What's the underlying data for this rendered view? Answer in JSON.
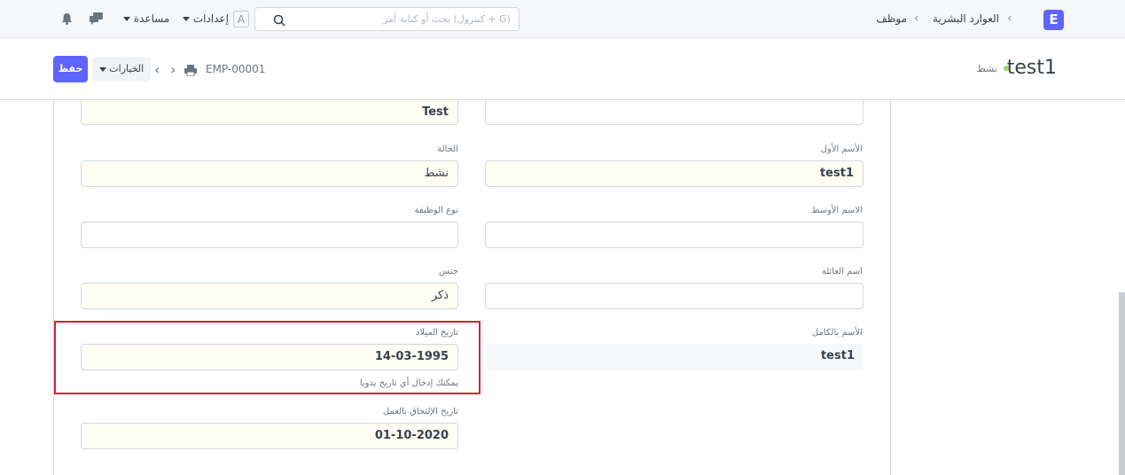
{
  "navbar": {
    "logo_letter": "E",
    "breadcrumbs": [
      "العوارد البشرية",
      "موظف"
    ],
    "search_placeholder": "بحث أو كتابة أمر (كنترول + G)",
    "avatar_letter": "A",
    "settings_label": "إعدادات",
    "help_label": "مساعدة"
  },
  "page_head": {
    "title": "test1",
    "status": "نشط",
    "status_color": "#98d85b",
    "doc_id": "EMP-00001",
    "options_label": "الخيارات",
    "save_label": "حفظ"
  },
  "form": {
    "top_left_value": "Test",
    "top_right_value": "",
    "first_name": {
      "label": "الأسم الأول",
      "value": "test1"
    },
    "status": {
      "label": "الحالة",
      "value": "نشط"
    },
    "middle_name": {
      "label": "الاسم الأوسط",
      "value": ""
    },
    "employment_type": {
      "label": "نوع الوظيفة",
      "value": ""
    },
    "last_name": {
      "label": "اسم العائلة",
      "value": ""
    },
    "gender": {
      "label": "جنس",
      "value": "ذكر"
    },
    "full_name": {
      "label": "الأسم بالكامل",
      "value": "test1"
    },
    "dob": {
      "label": "تاريخ الميلاد",
      "value": "14-03-1995",
      "description": "يمكنك إدخال أي تاريخ يدويا"
    },
    "joining_date": {
      "label": "تاريخ الإلتحاق بالعمل",
      "value": "01-10-2020"
    }
  },
  "colors": {
    "accent": "#5e64ff",
    "highlight_border": "#d0262d"
  }
}
